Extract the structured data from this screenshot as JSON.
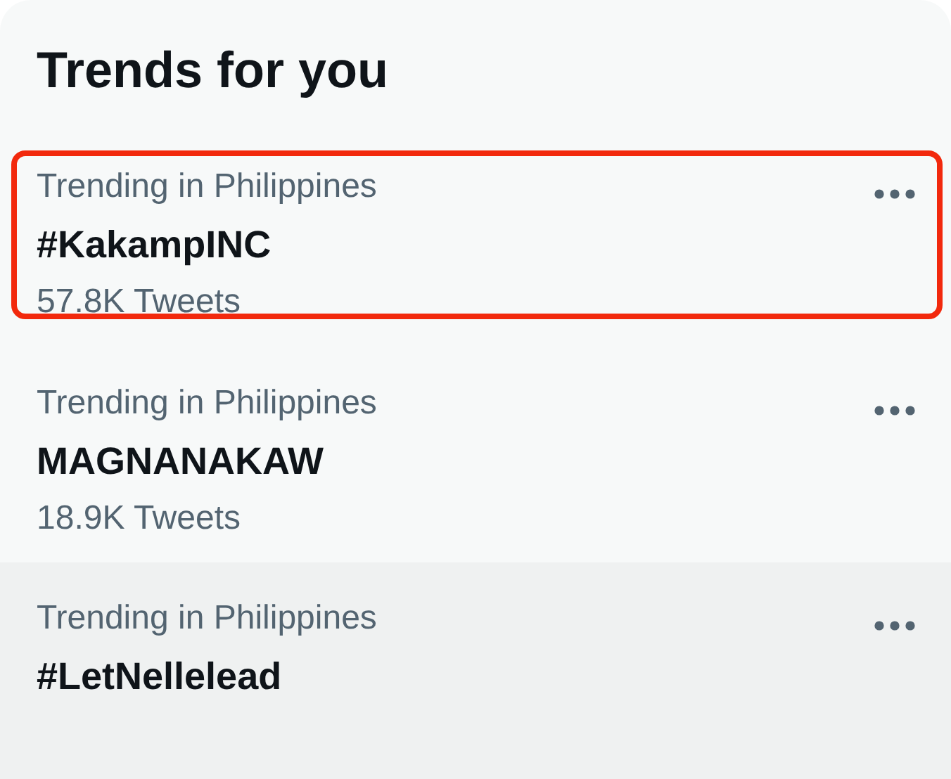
{
  "title": "Trends for you",
  "trends": [
    {
      "context": "Trending in Philippines",
      "name": "#KakampINC",
      "count": "57.8K Tweets",
      "highlighted": true,
      "hovered": false
    },
    {
      "context": "Trending in Philippines",
      "name": "MAGNANAKAW",
      "count": "18.9K Tweets",
      "highlighted": false,
      "hovered": false
    },
    {
      "context": "Trending in Philippines",
      "name": "#LetNellelead",
      "highlighted": false,
      "hovered": true
    }
  ]
}
